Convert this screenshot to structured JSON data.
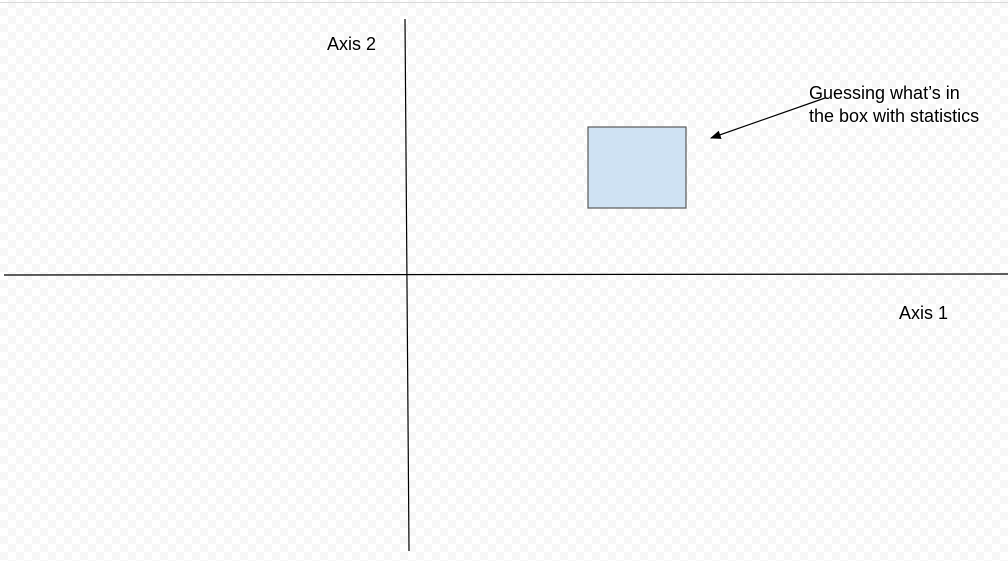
{
  "diagram": {
    "axis_horizontal_label": "Axis 1",
    "axis_vertical_label": "Axis 2",
    "annotation": {
      "line1": "Guessing what’s in",
      "line2": "the box with statistics"
    },
    "colors": {
      "box_fill": "#cfe2f3",
      "box_stroke": "#595959",
      "line": "#000000"
    }
  }
}
